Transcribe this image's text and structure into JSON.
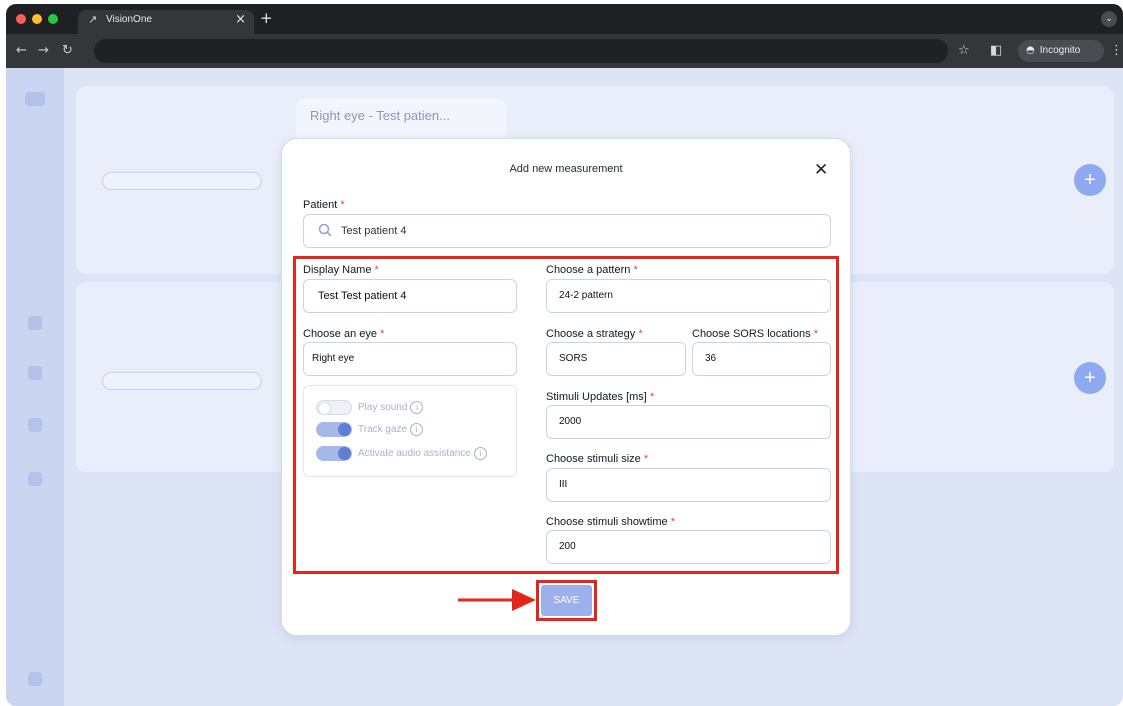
{
  "browser": {
    "tab_title": "VisionOne",
    "tab_close": "×",
    "new_tab": "+",
    "incognito_label": "Incognito",
    "tab_menu_icon": "chevron-down-icon"
  },
  "background": {
    "card_title": "Right eye - Test patien..."
  },
  "modal": {
    "title": "Add new measurement",
    "close_symbol": "✕",
    "patient": {
      "label": "Patient",
      "value": "Test patient 4"
    },
    "display_name": {
      "label": "Display Name",
      "value": "Test Test patient 4"
    },
    "eye": {
      "label": "Choose an eye",
      "value": "Right eye"
    },
    "options": {
      "play_sound": {
        "label": "Play sound",
        "enabled": false
      },
      "track_gaze": {
        "label": "Track gaze",
        "enabled": true
      },
      "audio_assistance": {
        "label": "Activate audio assistance",
        "enabled": true
      }
    },
    "pattern": {
      "label": "Choose a pattern",
      "value": "24-2 pattern"
    },
    "strategy": {
      "label": "Choose a strategy",
      "value": "SORS"
    },
    "sors_locations": {
      "label": "Choose SORS locations",
      "value": "36"
    },
    "stimuli_updates": {
      "label": "Stimuli Updates [ms]",
      "value": "2000"
    },
    "stimuli_size": {
      "label": "Choose stimuli size",
      "value": "III"
    },
    "stimuli_showtime": {
      "label": "Choose stimuli showtime",
      "value": "200"
    },
    "required_mark": "*",
    "info_mark": "i",
    "save_label": "SAVE"
  },
  "colors": {
    "highlight": "#e3251b",
    "accent": "#9db0ec",
    "required": "#e0453e"
  }
}
